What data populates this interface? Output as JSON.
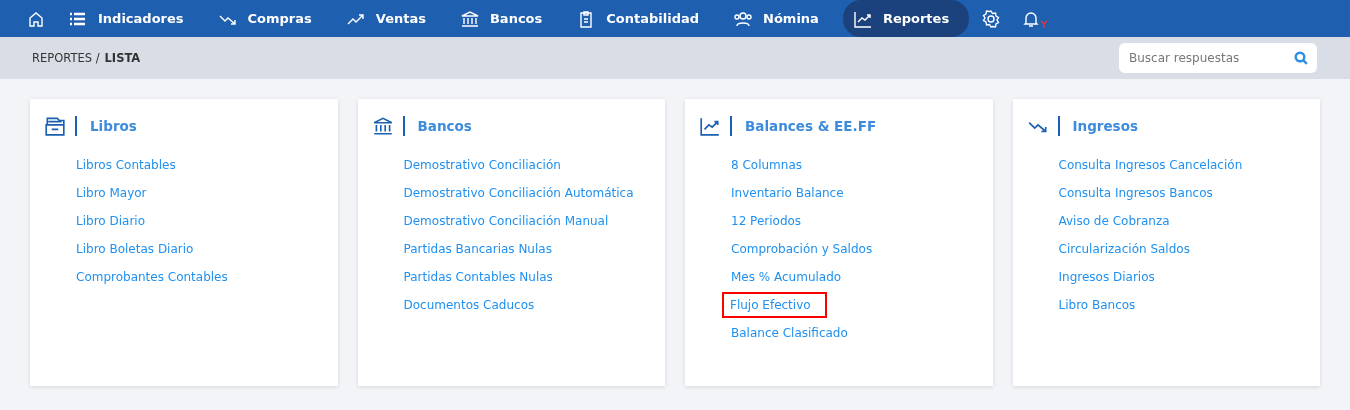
{
  "nav": {
    "items": [
      {
        "kind": "home",
        "selected": false
      },
      {
        "kind": "list",
        "label": "Indicadores",
        "selected": false
      },
      {
        "kind": "down",
        "label": "Compras",
        "selected": false
      },
      {
        "kind": "up",
        "label": "Ventas",
        "selected": false
      },
      {
        "kind": "bank",
        "label": "Bancos",
        "selected": false
      },
      {
        "kind": "clipboard",
        "label": "Contabilidad",
        "selected": false
      },
      {
        "kind": "people",
        "label": "Nómina",
        "selected": false
      },
      {
        "kind": "chart",
        "label": "Reportes",
        "selected": true
      },
      {
        "kind": "gear",
        "selected": false
      },
      {
        "kind": "bell",
        "selected": false
      }
    ]
  },
  "breadcrumb": {
    "parent": "REPORTES /",
    "current": "LISTA"
  },
  "search": {
    "placeholder": "Buscar respuestas"
  },
  "cards": [
    {
      "kind": "drawer",
      "title": "Libros",
      "links": [
        {
          "label": "Libros Contables",
          "highlighted": false
        },
        {
          "label": "Libro Mayor",
          "highlighted": false
        },
        {
          "label": "Libro Diario",
          "highlighted": false
        },
        {
          "label": "Libro Boletas Diario",
          "highlighted": false
        },
        {
          "label": "Comprobantes Contables",
          "highlighted": false
        }
      ]
    },
    {
      "kind": "bank",
      "title": "Bancos",
      "links": [
        {
          "label": "Demostrativo Conciliación",
          "highlighted": false
        },
        {
          "label": "Demostrativo Conciliación Automática",
          "highlighted": false
        },
        {
          "label": "Demostrativo Conciliación Manual",
          "highlighted": false
        },
        {
          "label": "Partidas Bancarias Nulas",
          "highlighted": false
        },
        {
          "label": "Partidas Contables Nulas",
          "highlighted": false
        },
        {
          "label": "Documentos Caducos",
          "highlighted": false
        }
      ]
    },
    {
      "kind": "chart",
      "title": "Balances & EE.FF",
      "links": [
        {
          "label": "8 Columnas",
          "highlighted": false
        },
        {
          "label": "Inventario Balance",
          "highlighted": false
        },
        {
          "label": "12 Periodos",
          "highlighted": false
        },
        {
          "label": "Comprobación y Saldos",
          "highlighted": false
        },
        {
          "label": "Mes % Acumulado",
          "highlighted": false
        },
        {
          "label": "Flujo Efectivo",
          "highlighted": true
        },
        {
          "label": "Balance Clasificado",
          "highlighted": false
        }
      ]
    },
    {
      "kind": "down",
      "title": "Ingresos",
      "links": [
        {
          "label": "Consulta Ingresos Cancelación",
          "highlighted": false
        },
        {
          "label": "Consulta Ingresos Bancos",
          "highlighted": false
        },
        {
          "label": "Aviso de Cobranza",
          "highlighted": false
        },
        {
          "label": "Circularización Saldos",
          "highlighted": false
        },
        {
          "label": "Ingresos Diarios",
          "highlighted": false
        },
        {
          "label": "Libro Bancos",
          "highlighted": false
        }
      ]
    }
  ]
}
